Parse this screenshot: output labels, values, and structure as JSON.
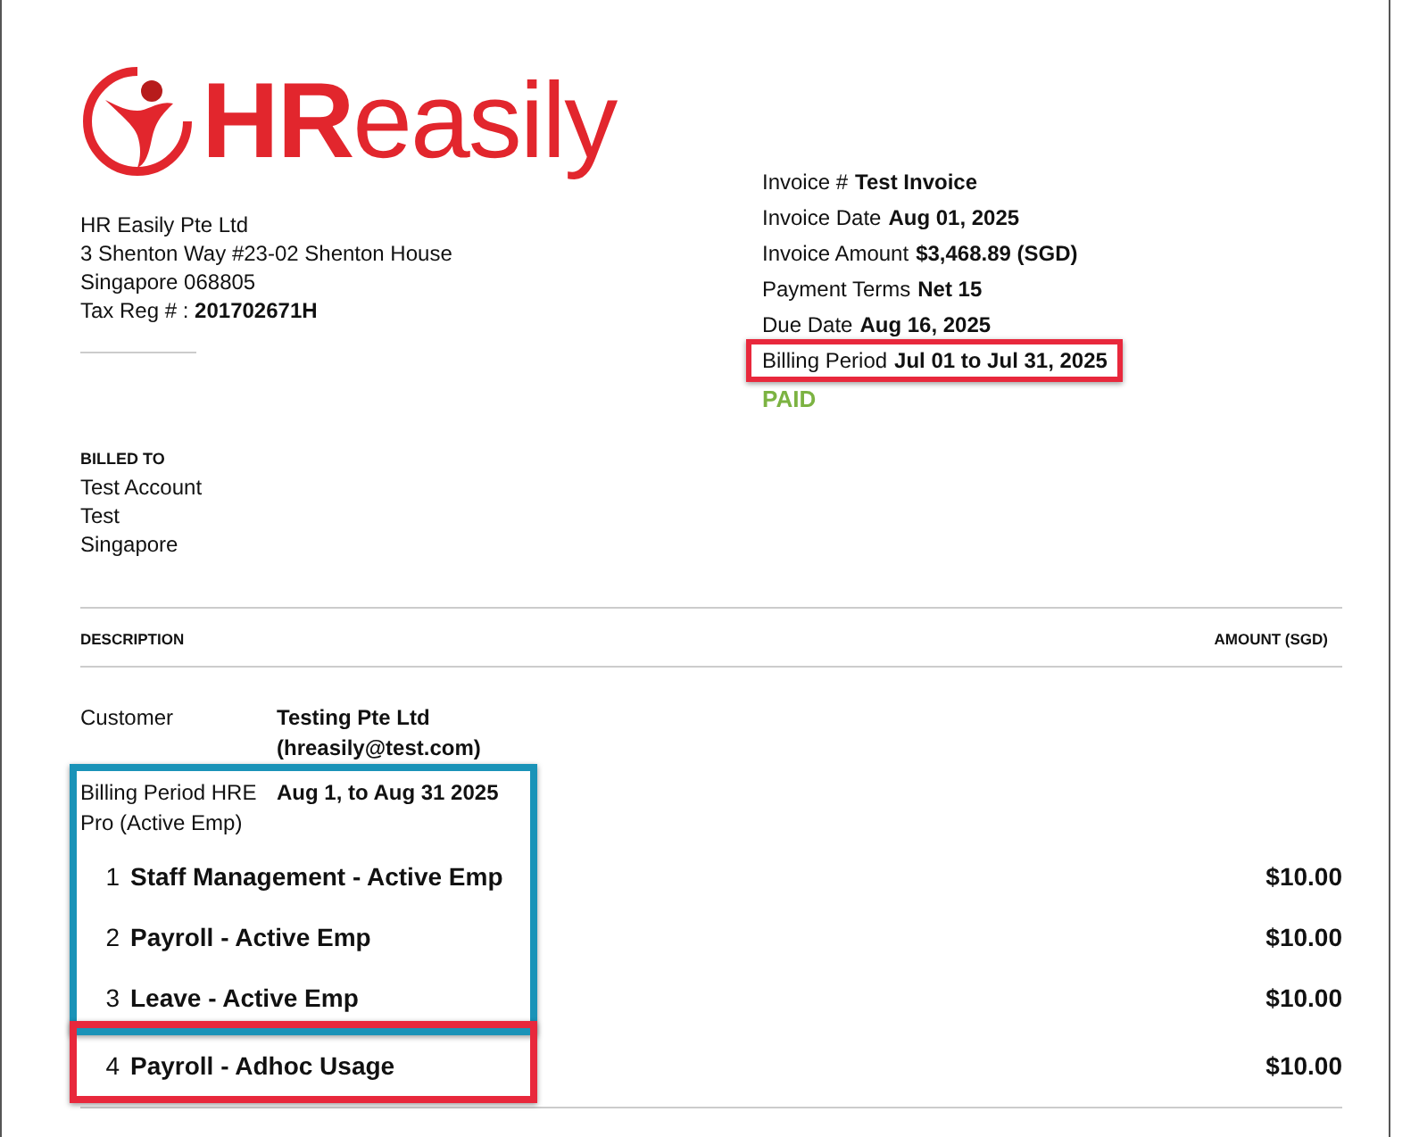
{
  "logo": {
    "text": "**HR**easily"
  },
  "company": {
    "lines": [
      "HR Easily Pte Ltd",
      "3 Shenton Way #23-02 Shenton House",
      "Singapore 068805"
    ],
    "tax_label": "Tax Reg # :",
    "tax_value": "201702671H"
  },
  "invoice_meta": [
    {
      "label": "Invoice #",
      "value": "Test Invoice",
      "highlighted": false
    },
    {
      "label": "Invoice Date",
      "value": "Aug 01, 2025",
      "highlighted": false
    },
    {
      "label": "Invoice Amount",
      "value": "$3,468.89 (SGD)",
      "highlighted": false
    },
    {
      "label": "Payment Terms",
      "value": "Net 15",
      "highlighted": false
    },
    {
      "label": "Due Date",
      "value": "Aug 16, 2025",
      "highlighted": false
    },
    {
      "label": "Billing Period",
      "value": "Jul 01 to Jul 31, 2025",
      "highlighted": true
    }
  ],
  "status": "PAID",
  "billed_to": {
    "heading": "BILLED TO",
    "lines": [
      "Test Account",
      "Test",
      "Singapore"
    ]
  },
  "table": {
    "columns": [
      "DESCRIPTION",
      "AMOUNT (SGD)"
    ],
    "details": [
      {
        "label": "Customer",
        "value": "Testing Pte Ltd (hreasily@test.com)"
      }
    ],
    "groups": [
      {
        "color": "#1a93b8",
        "detail": {
          "label": "Billing Period HRE Pro (Active Emp)",
          "value": "Aug 1, to Aug 31 2025"
        },
        "items": [
          {
            "number": "1",
            "name": "Staff Management - Active Emp",
            "amount": "$10.00"
          },
          {
            "number": "2",
            "name": "Payroll - Active Emp",
            "amount": "$10.00"
          },
          {
            "number": "3",
            "name": "Leave - Active Emp",
            "amount": "$10.00"
          }
        ]
      },
      {
        "color": "#e8283c",
        "items": [
          {
            "number": "4",
            "name": "Payroll - Adhoc Usage",
            "amount": "$10.00"
          }
        ]
      }
    ]
  }
}
